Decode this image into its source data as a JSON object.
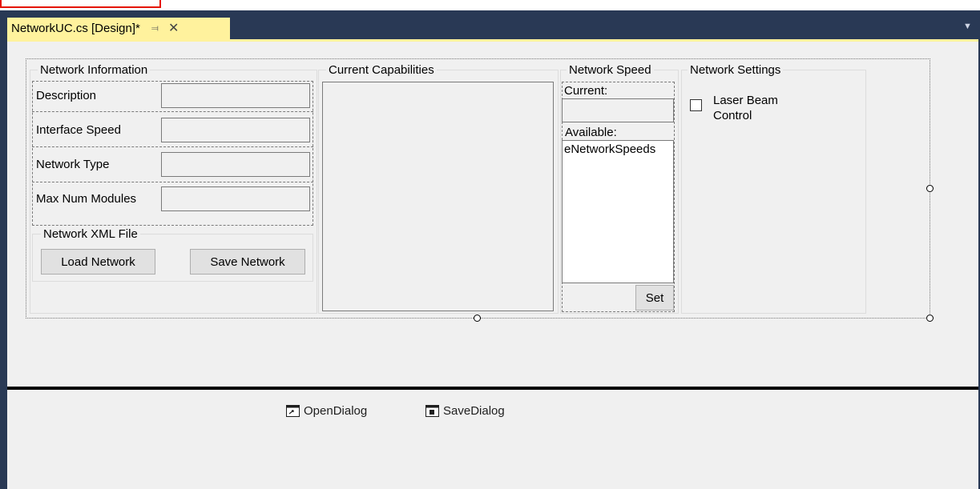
{
  "tab": {
    "title": "NetworkUC.cs [Design]*"
  },
  "network_information": {
    "title": "Network Information",
    "fields": [
      {
        "label": "Description",
        "value": ""
      },
      {
        "label": "Interface Speed",
        "value": ""
      },
      {
        "label": "Network Type",
        "value": ""
      },
      {
        "label": "Max Num Modules",
        "value": ""
      }
    ],
    "xml_file": {
      "title": "Network XML File",
      "load_label": "Load Network",
      "save_label": "Save Network"
    }
  },
  "current_capabilities": {
    "title": "Current Capabilities"
  },
  "network_speed": {
    "title": "Network Speed",
    "current_label": "Current:",
    "current_value": "",
    "available_label": "Available:",
    "available_items": [
      "eNetworkSpeeds"
    ],
    "set_label": "Set"
  },
  "network_settings": {
    "title": "Network Settings",
    "laser_line1": "Laser Beam",
    "laser_line2": "Control",
    "laser_checked": false
  },
  "tray": {
    "open_dialog": "OpenDialog",
    "save_dialog": "SaveDialog"
  },
  "colors": {
    "frame": "#293955",
    "tab_active": "#fff29d",
    "surface": "#f0f0f0",
    "highlight": "#e51400"
  }
}
